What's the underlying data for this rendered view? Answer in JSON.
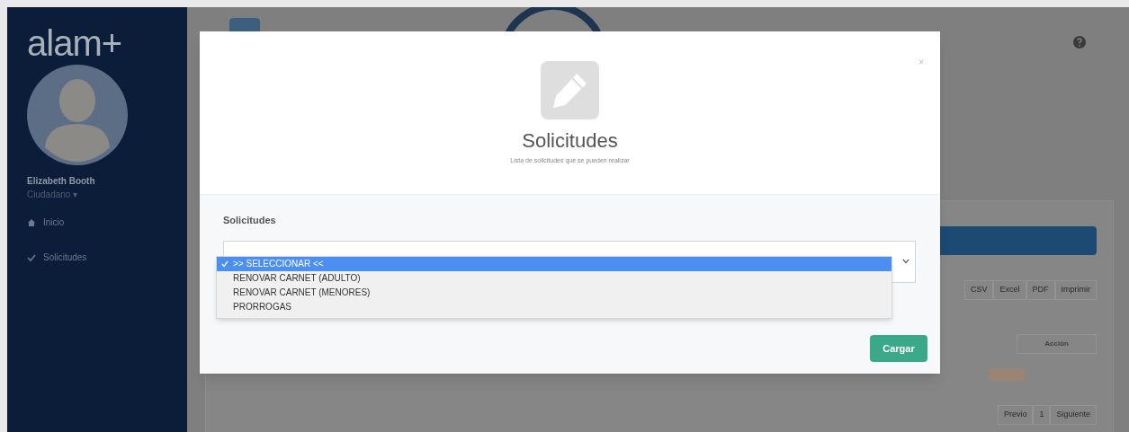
{
  "app": {
    "logo": "alam+",
    "user": {
      "name": "Elizabeth Booth",
      "role": "Ciudadano ▾"
    },
    "nav": [
      {
        "label": "Inicio",
        "kind": "home",
        "selected": false
      },
      {
        "label": "Solicitudes",
        "kind": "check",
        "selected": false
      }
    ]
  },
  "page": {
    "export_buttons": [
      "CSV",
      "Excel",
      "PDF",
      "Imprimir"
    ],
    "table": {
      "columns": [
        "Acción"
      ]
    },
    "pagination": [
      "Previo",
      "1",
      "Siguiente"
    ]
  },
  "modal": {
    "close": "×",
    "title": "Solicitudes",
    "subtitle": "Lista de solicitudes que se pueden realizar",
    "field_label": "Solicitudes",
    "options": [
      {
        "label": ">> SELECCIONAR <<",
        "selected": true
      },
      {
        "label": "RENOVAR CARNET (ADULTO)",
        "selected": false
      },
      {
        "label": "RENOVAR CARNET (MENORES)",
        "selected": false
      },
      {
        "label": "PRORROGAS",
        "selected": false
      }
    ],
    "submit": "Cargar"
  }
}
